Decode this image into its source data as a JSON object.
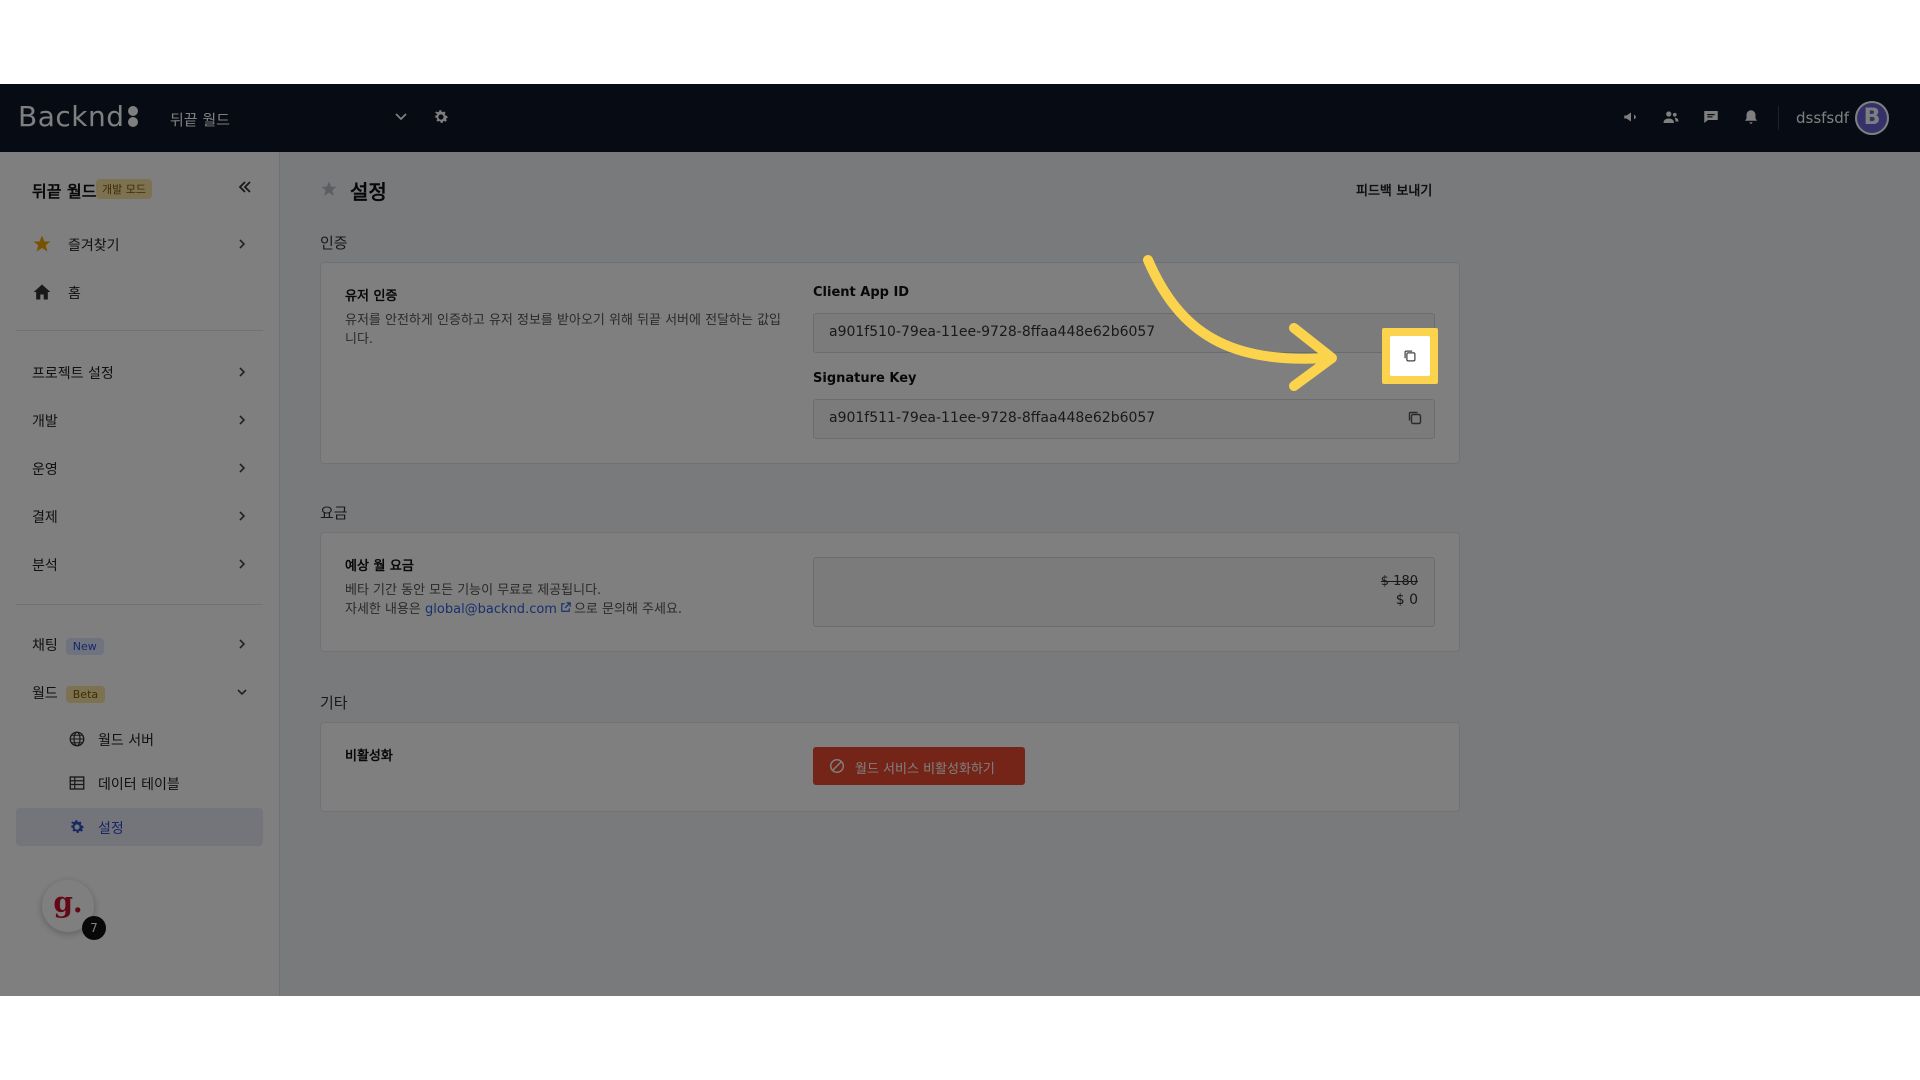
{
  "brand": {
    "logo_text": "Backnd"
  },
  "topbar": {
    "project_name": "뒤끝 월드",
    "user_name": "dssfsdf",
    "avatar_letter": "B",
    "icons": [
      "megaphone-icon",
      "users-icon",
      "chat-icon",
      "bell-icon",
      "gear-icon",
      "chevron-down-icon"
    ]
  },
  "sidebar": {
    "title": "뒤끝 월드",
    "mode_badge": "개발 모드",
    "favorites": "즐겨찾기",
    "home": "홈",
    "project_settings": "프로젝트 설정",
    "development": "개발",
    "operation": "운영",
    "payment": "결제",
    "analytics": "분석",
    "chatting": "채팅",
    "new_badge": "New",
    "world": "월드",
    "beta_badge": "Beta",
    "world_server": "월드 서버",
    "data_table": "데이터 테이블",
    "settings": "설정",
    "chat_bubble_letter": "g.",
    "chat_count": "7"
  },
  "main": {
    "page_title": "설정",
    "feedback_label": "피드백 보내기",
    "auth": {
      "section_title": "인증",
      "card_title": "유저 인증",
      "card_desc": "유저를 안전하게 인증하고 유저 정보를 받아오기 위해 뒤끝 서버에 전달하는 값입니다.",
      "client_app_id_label": "Client App ID",
      "client_app_id_value": "a901f510-79ea-11ee-9728-8ffaa448e62b6057",
      "signature_key_label": "Signature Key",
      "signature_key_value": "a901f511-79ea-11ee-9728-8ffaa448e62b6057"
    },
    "billing": {
      "section_title": "요금",
      "card_title": "예상 월 요금",
      "desc_line1": "베타 기간 동안 모든 기능이 무료로 제공됩니다.",
      "desc_line2_prefix": "자세한 내용은 ",
      "email": "global@backnd.com",
      "desc_line2_suffix": "으로 문의해 주세요.",
      "old_price": "$ 180",
      "new_price": "$ 0"
    },
    "other": {
      "section_title": "기타",
      "card_title": "비활성화",
      "deactivate_label": "월드 서비스 비활성화하기"
    }
  },
  "colors": {
    "topbar_bg": "#0f1726",
    "accent_blue": "#2f4fc9",
    "danger": "#e94a2f",
    "highlight": "#fcd34d"
  }
}
